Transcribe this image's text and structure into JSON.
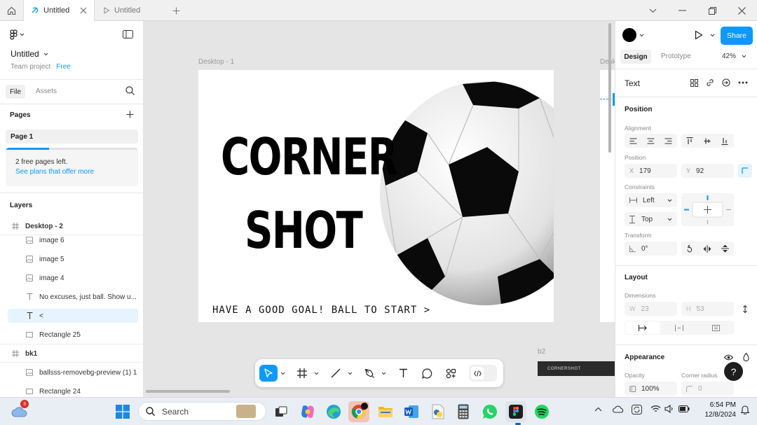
{
  "tabs": {
    "active_label": "Untitled",
    "inactive_label": "Untitled"
  },
  "left": {
    "file_name": "Untitled",
    "team_label": "Team project",
    "plan_badge": "Free",
    "tab_file": "File",
    "tab_assets": "Assets",
    "pages_heading": "Pages",
    "page_1": "Page 1",
    "free_pages_text": "2 free pages left.",
    "plans_link": "See plans that offer more",
    "layers_heading": "Layers",
    "layers": [
      {
        "label": "Desktop - 2",
        "icon": "frame-icon"
      },
      {
        "label": "image 6",
        "icon": "image-icon"
      },
      {
        "label": "image 5",
        "icon": "image-icon"
      },
      {
        "label": "image 4",
        "icon": "image-icon"
      },
      {
        "label": "No excuses, just ball. Show u...",
        "icon": "text-icon"
      },
      {
        "label": "<",
        "icon": "text-icon"
      },
      {
        "label": "Rectangle 25",
        "icon": "rectangle-icon"
      },
      {
        "label": "bk1",
        "icon": "frame-icon"
      },
      {
        "label": "ballsss-removebg-preview (1) 1",
        "icon": "image-icon"
      },
      {
        "label": "Rectangle 24",
        "icon": "rectangle-icon"
      }
    ]
  },
  "canvas": {
    "frame_label": "Desktop - 1",
    "frame_label_cut": "Desk",
    "headline_1": "CORNER",
    "headline_2": "SHOT",
    "tagline": "HAVE A GOOD GOAL! BALL TO START >",
    "frame_b2_label": "b2",
    "frame_b2_text": "CORNERSHOT"
  },
  "right": {
    "share_label": "Share",
    "tab_design": "Design",
    "tab_prototype": "Prototype",
    "zoom": "42%",
    "section_title": "Text",
    "position_heading": "Position",
    "alignment_label": "Alignment",
    "position_label": "Position",
    "x_prefix": "X",
    "x_value": "179",
    "y_prefix": "Y",
    "y_value": "92",
    "constraints_label": "Constraints",
    "constraint_h": "Left",
    "constraint_v": "Top",
    "transform_label": "Transform",
    "rotation": "0°",
    "layout_heading": "Layout",
    "dimensions_label": "Dimensions",
    "w_prefix": "W",
    "w_value": "23",
    "h_prefix": "H",
    "h_value": "53",
    "appearance_heading": "Appearance",
    "opacity_label": "Opacity",
    "opacity_value": "100%",
    "corner_label": "Corner radius",
    "corner_value": "0",
    "help_label": "?"
  },
  "taskbar": {
    "search_placeholder": "Search",
    "notification_count": "3",
    "time": "6:54 PM",
    "date": "12/8/2024"
  },
  "colors": {
    "accent": "#0d99ff",
    "selection": "#e5f4ff"
  }
}
